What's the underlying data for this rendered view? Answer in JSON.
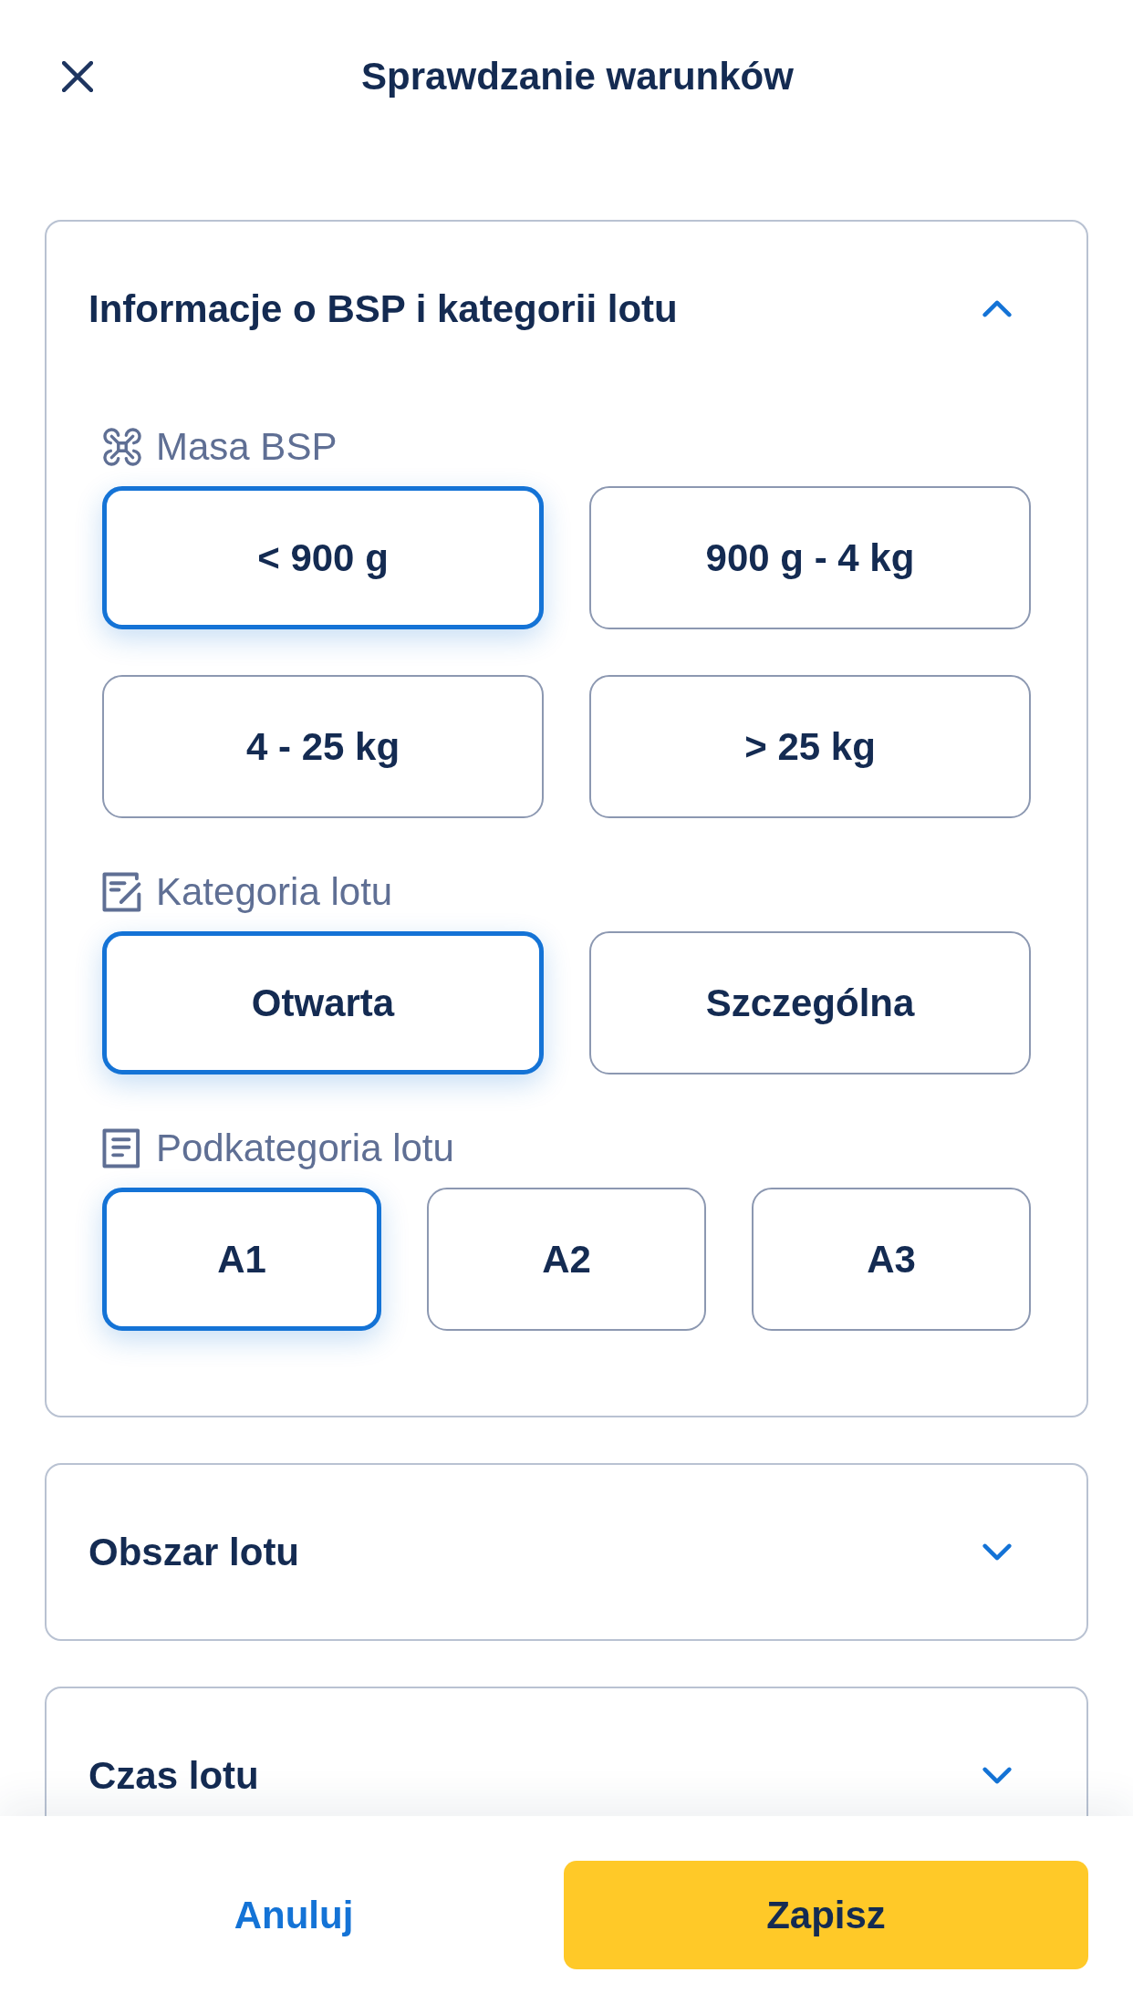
{
  "header": {
    "title": "Sprawdzanie warunków"
  },
  "sections": [
    {
      "title": "Informacje o BSP i kategorii lotu",
      "expanded": true,
      "groups": [
        {
          "label": "Masa BSP",
          "options": [
            {
              "label": "< 900 g",
              "selected": true
            },
            {
              "label": "900 g - 4 kg",
              "selected": false
            },
            {
              "label": "4 - 25 kg",
              "selected": false
            },
            {
              "label": "> 25 kg",
              "selected": false
            }
          ]
        },
        {
          "label": "Kategoria lotu",
          "options": [
            {
              "label": "Otwarta",
              "selected": true
            },
            {
              "label": "Szczególna",
              "selected": false
            }
          ]
        },
        {
          "label": "Podkategoria lotu",
          "options": [
            {
              "label": "A1",
              "selected": true
            },
            {
              "label": "A2",
              "selected": false
            },
            {
              "label": "A3",
              "selected": false
            }
          ]
        }
      ]
    },
    {
      "title": "Obszar lotu",
      "expanded": false
    },
    {
      "title": "Czas lotu",
      "expanded": false
    }
  ],
  "footer": {
    "buttons": [
      {
        "label": "Anuluj",
        "kind": "link"
      },
      {
        "label": "Zapisz",
        "kind": "primary"
      }
    ]
  }
}
